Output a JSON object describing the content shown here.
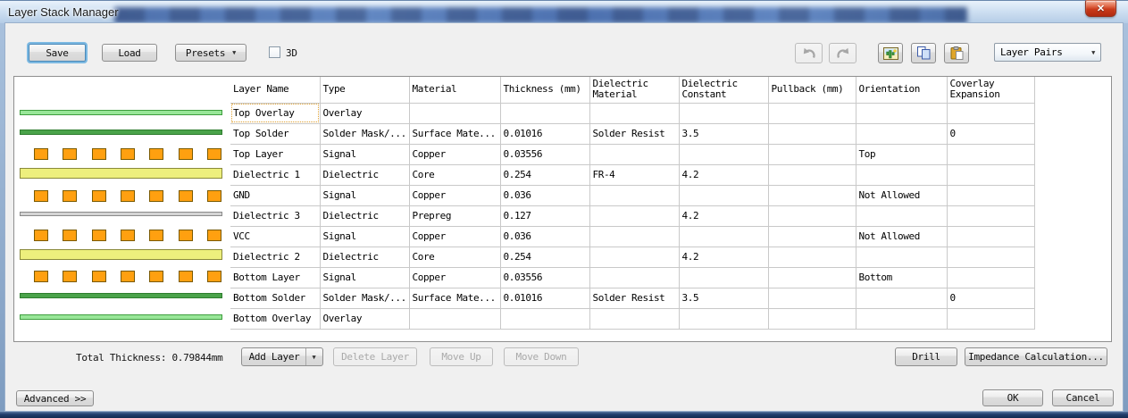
{
  "window": {
    "title": "Layer Stack Manager"
  },
  "icons": {
    "close_glyph": "✕",
    "dropdown_arrow": "▼"
  },
  "toolbar": {
    "save_label": "Save",
    "load_label": "Load",
    "presets_label": "Presets",
    "threed_label": "3D",
    "threed_checked": false,
    "layer_pairs_label": "Layer Pairs"
  },
  "stack_preview": {
    "layers": [
      "overlay",
      "solder",
      "copper",
      "core",
      "copper",
      "prepreg",
      "copper",
      "core",
      "copper",
      "solder",
      "overlay"
    ]
  },
  "table": {
    "columns": [
      "Layer Name",
      "Type",
      "Material",
      "Thickness (mm)",
      "Dielectric Material",
      "Dielectric Constant",
      "Pullback (mm)",
      "Orientation",
      "Coverlay Expansion"
    ],
    "rows": [
      [
        "Top Overlay",
        "Overlay",
        "",
        "",
        "",
        "",
        "",
        "",
        ""
      ],
      [
        "Top Solder",
        "Solder Mask/...",
        "Surface Mate...",
        "0.01016",
        "Solder Resist",
        "3.5",
        "",
        "",
        "0"
      ],
      [
        "Top Layer",
        "Signal",
        "Copper",
        "0.03556",
        "",
        "",
        "",
        "Top",
        ""
      ],
      [
        "Dielectric 1",
        "Dielectric",
        "Core",
        "0.254",
        "FR-4",
        "4.2",
        "",
        "",
        ""
      ],
      [
        "GND",
        "Signal",
        "Copper",
        "0.036",
        "",
        "",
        "",
        "Not Allowed",
        ""
      ],
      [
        "Dielectric 3",
        "Dielectric",
        "Prepreg",
        "0.127",
        "",
        "4.2",
        "",
        "",
        ""
      ],
      [
        "VCC",
        "Signal",
        "Copper",
        "0.036",
        "",
        "",
        "",
        "Not Allowed",
        ""
      ],
      [
        "Dielectric 2",
        "Dielectric",
        "Core",
        "0.254",
        "",
        "4.2",
        "",
        "",
        ""
      ],
      [
        "Bottom Layer",
        "Signal",
        "Copper",
        "0.03556",
        "",
        "",
        "",
        "Bottom",
        ""
      ],
      [
        "Bottom Solder",
        "Solder Mask/...",
        "Surface Mate...",
        "0.01016",
        "Solder Resist",
        "3.5",
        "",
        "",
        "0"
      ],
      [
        "Bottom Overlay",
        "Overlay",
        "",
        "",
        "",
        "",
        "",
        "",
        ""
      ]
    ],
    "selected_cell": {
      "row": 0,
      "col": 0
    }
  },
  "footer": {
    "total_thickness_label": "Total Thickness: 0.79844mm",
    "add_layer_label": "Add Layer",
    "delete_layer_label": "Delete Layer",
    "move_up_label": "Move Up",
    "move_down_label": "Move Down",
    "drill_label": "Drill",
    "impedance_label": "Impedance Calculation..."
  },
  "bottom_bar": {
    "advanced_label": "Advanced >>",
    "ok_label": "OK",
    "cancel_label": "Cancel"
  },
  "colors": {
    "overlay": "#98e698",
    "overlay_border": "#3e9e3e",
    "solder": "#4aa34a",
    "solder_border": "#2e7d2e",
    "copper": "#ffa010",
    "copper_border": "#7a5a00",
    "core": "#edef7d",
    "core_border": "#8a8a3a",
    "prepreg": "#d4d4d4",
    "prepreg_border": "#8a8a8a",
    "selected_outline": "#e0a030"
  }
}
